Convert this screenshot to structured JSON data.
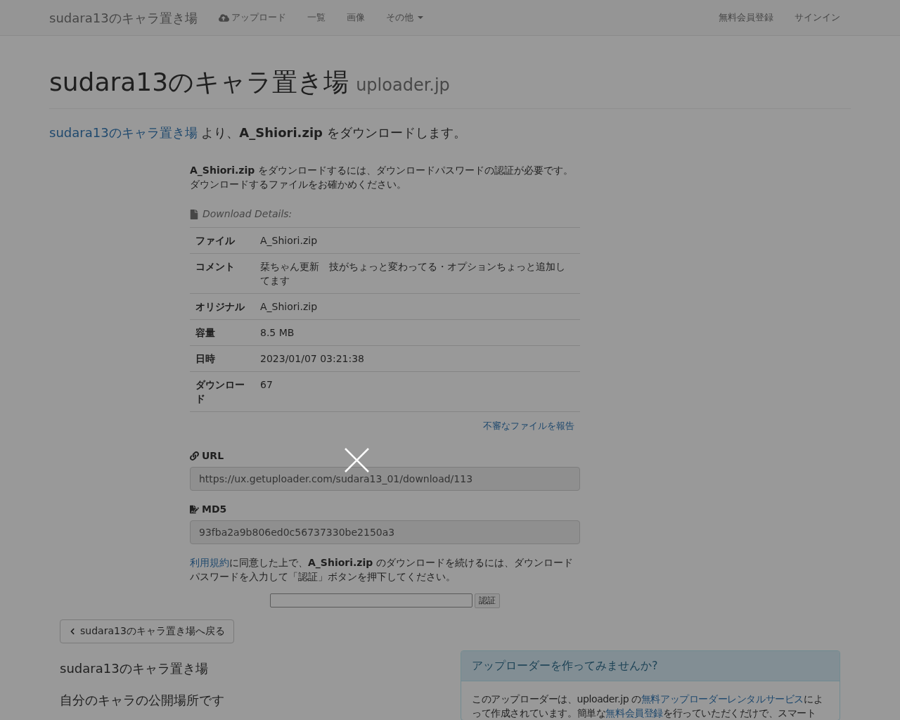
{
  "navbar": {
    "brand": "sudara13のキャラ置き場",
    "items": [
      {
        "label": "アップロード",
        "kind": "upload"
      },
      {
        "label": "一覧",
        "kind": "plain"
      },
      {
        "label": "画像",
        "kind": "plain"
      },
      {
        "label": "その他",
        "kind": "dropdown"
      }
    ],
    "right_items": [
      "無料会員登録",
      "サインイン"
    ]
  },
  "header": {
    "title": "sudara13のキャラ置き場",
    "subtitle": "uploader.jp"
  },
  "lead": [
    {
      "kind": "link",
      "text": "sudara13のキャラ置き場"
    },
    {
      "kind": "text",
      "text": " より、**A_Shiori.zip** をダウンロードします。"
    }
  ],
  "intro": "**A_Shiori.zip** をダウンロードするには、ダウンロードパスワードの認証が必要です。ダウンロードするファイルをお確かめください。",
  "details": {
    "caption": "Download Details:",
    "rows": [
      {
        "label": "ファイル",
        "value": "A_Shiori.zip"
      },
      {
        "label": "コメント",
        "value": "栞ちゃん更新　技がちょっと変わってる・オプションちょっと追加してます"
      },
      {
        "label": "オリジナル",
        "value": "A_Shiori.zip"
      },
      {
        "label": "容量",
        "value": "8.5 MB"
      },
      {
        "label": "日時",
        "value": "2023/01/07 03:21:38"
      },
      {
        "label": "ダウンロード",
        "value": "67"
      }
    ],
    "report_link": "不審なファイルを報告"
  },
  "url": {
    "label": "URL",
    "value": "https://ux.getuploader.com/sudara13_01/download/113"
  },
  "md5": {
    "label": "MD5",
    "value": "93fba2a9b806ed0c56737330be2150a3"
  },
  "terms": [
    {
      "kind": "link",
      "text": "利用規約"
    },
    {
      "kind": "text",
      "text": "に同意した上で、**A_Shiori.zip** のダウンロードを続けるには、ダウンロードパスワードを入力して「認証」ボタンを押下してください。"
    }
  ],
  "password": {
    "button": "認証"
  },
  "back_button": "sudara13のキャラ置き場へ戻る",
  "site": {
    "name": "sudara13のキャラ置き場",
    "description": "自分のキャラの公開場所です"
  },
  "promo": {
    "heading": "アップローダーを作ってみませんか?",
    "body": [
      {
        "kind": "text",
        "text": "このアップローダーは、uploader.jp の"
      },
      {
        "kind": "link",
        "text": "無料アップローダーレンタルサービス"
      },
      {
        "kind": "text",
        "text": "によって作成されています。簡単な"
      },
      {
        "kind": "link",
        "text": "無料会員登録"
      },
      {
        "kind": "text",
        "text": "を行っていただくだけで、スマート"
      }
    ]
  },
  "lightbox": {
    "open": true
  }
}
